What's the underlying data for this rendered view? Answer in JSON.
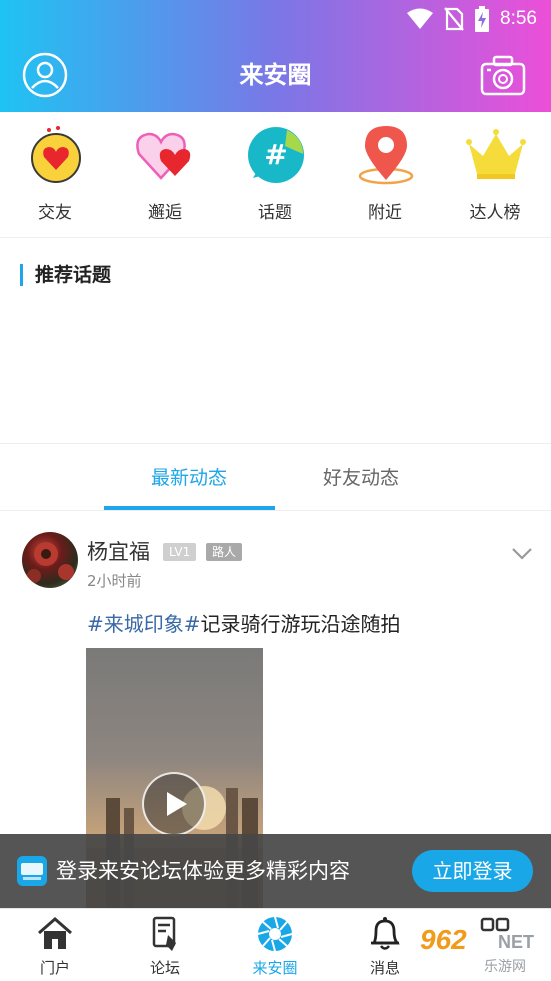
{
  "status_bar": {
    "time": "8:56"
  },
  "header": {
    "title": "来安圈"
  },
  "quick_links": [
    {
      "label": "交友",
      "icon": "heart-chat-icon"
    },
    {
      "label": "邂逅",
      "icon": "double-heart-icon"
    },
    {
      "label": "话题",
      "icon": "hashtag-icon"
    },
    {
      "label": "附近",
      "icon": "location-pin-icon"
    },
    {
      "label": "达人榜",
      "icon": "crown-icon"
    }
  ],
  "recommended": {
    "title": "推荐话题"
  },
  "tabs": [
    {
      "label": "最新动态",
      "active": true
    },
    {
      "label": "好友动态",
      "active": false
    }
  ],
  "post": {
    "author": "杨宜福",
    "level": "LV1",
    "role": "路人",
    "time": "2小时前",
    "tag": "#来城印象#",
    "text": "记录骑行游玩沿途随拍"
  },
  "login_banner": {
    "text": "登录来安论坛体验更多精彩内容",
    "button": "立即登录"
  },
  "bottom_nav": [
    {
      "label": "门户",
      "icon": "home-icon",
      "active": false
    },
    {
      "label": "论坛",
      "icon": "forum-icon",
      "active": false
    },
    {
      "label": "来安圈",
      "icon": "aperture-icon",
      "active": true
    },
    {
      "label": "消息",
      "icon": "bell-icon",
      "active": false
    },
    {
      "label": "",
      "icon": "grid-icon",
      "active": false
    }
  ],
  "watermark": {
    "brand": "962",
    "net": "NET",
    "sub": "乐游网"
  },
  "colors": {
    "accent": "#1aa7e8",
    "gradient_start": "#1fc3f3",
    "gradient_end": "#ec4fd8",
    "tag": "#3a6aa6"
  }
}
